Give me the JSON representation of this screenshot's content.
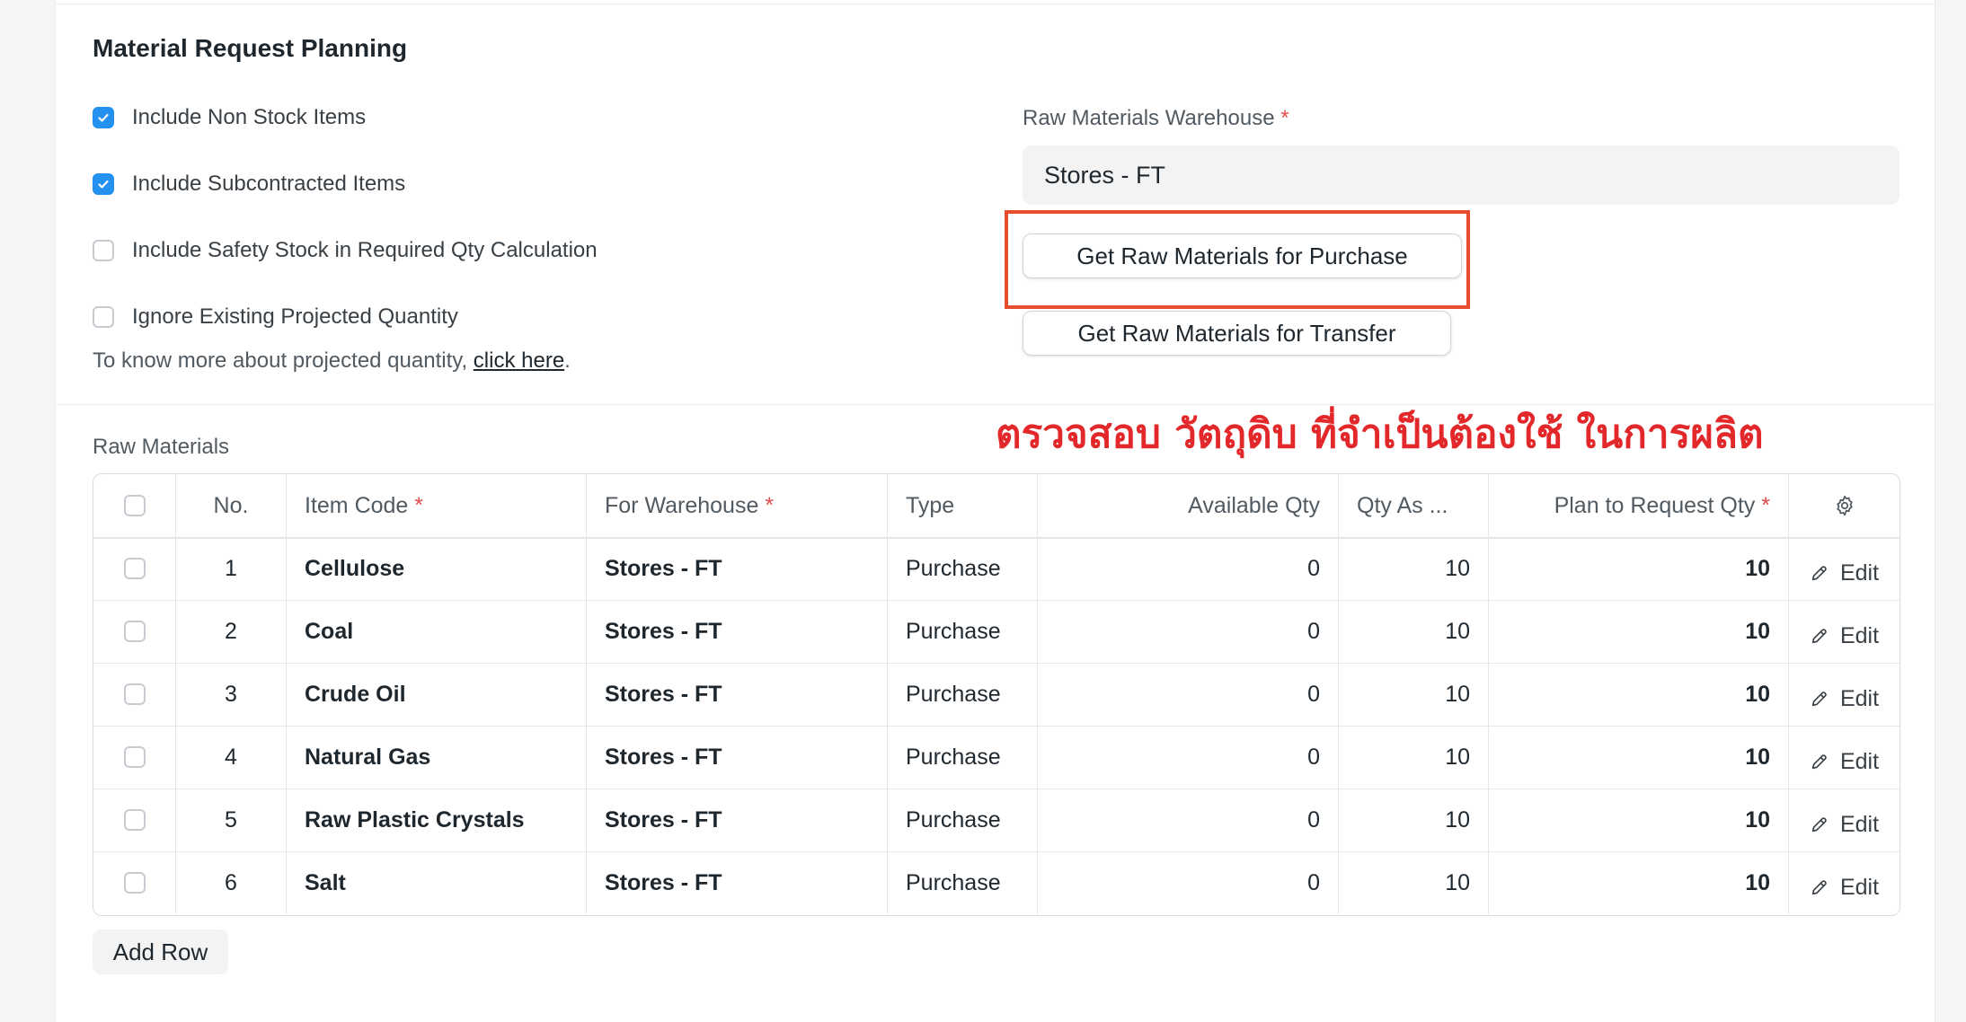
{
  "section": {
    "title": "Material Request Planning",
    "checks": [
      {
        "label": "Include Non Stock Items",
        "checked": true
      },
      {
        "label": "Include Subcontracted Items",
        "checked": true
      },
      {
        "label": "Include Safety Stock in Required Qty Calculation",
        "checked": false
      },
      {
        "label": "Ignore Existing Projected Quantity",
        "checked": false
      }
    ],
    "help_prefix": "To know more about projected quantity, ",
    "help_link": "click here",
    "help_suffix": "."
  },
  "warehouse": {
    "label": "Raw Materials Warehouse",
    "required_mark": "*",
    "value": "Stores - FT"
  },
  "buttons": {
    "purchase": "Get Raw Materials for Purchase",
    "transfer": "Get Raw Materials for Transfer",
    "add_row": "Add Row"
  },
  "annotation": "ตรวจสอบ วัตถุดิบ ที่จำเป็นต้องใช้ ในการผลิต",
  "raw_materials": {
    "label": "Raw Materials",
    "columns": {
      "no": "No.",
      "item_code": "Item Code",
      "for_warehouse": "For Warehouse",
      "type": "Type",
      "available_qty": "Available Qty",
      "qty_as": "Qty As ...",
      "plan_qty": "Plan to Request Qty",
      "required_mark": "*"
    },
    "edit_label": "Edit",
    "rows": [
      {
        "no": "1",
        "item_code": "Cellulose",
        "warehouse": "Stores - FT",
        "type": "Purchase",
        "available": "0",
        "qty_as": "10",
        "plan": "10"
      },
      {
        "no": "2",
        "item_code": "Coal",
        "warehouse": "Stores - FT",
        "type": "Purchase",
        "available": "0",
        "qty_as": "10",
        "plan": "10"
      },
      {
        "no": "3",
        "item_code": "Crude Oil",
        "warehouse": "Stores - FT",
        "type": "Purchase",
        "available": "0",
        "qty_as": "10",
        "plan": "10"
      },
      {
        "no": "4",
        "item_code": "Natural Gas",
        "warehouse": "Stores - FT",
        "type": "Purchase",
        "available": "0",
        "qty_as": "10",
        "plan": "10"
      },
      {
        "no": "5",
        "item_code": "Raw Plastic Crystals",
        "warehouse": "Stores - FT",
        "type": "Purchase",
        "available": "0",
        "qty_as": "10",
        "plan": "10"
      },
      {
        "no": "6",
        "item_code": "Salt",
        "warehouse": "Stores - FT",
        "type": "Purchase",
        "available": "0",
        "qty_as": "10",
        "plan": "10"
      }
    ]
  }
}
